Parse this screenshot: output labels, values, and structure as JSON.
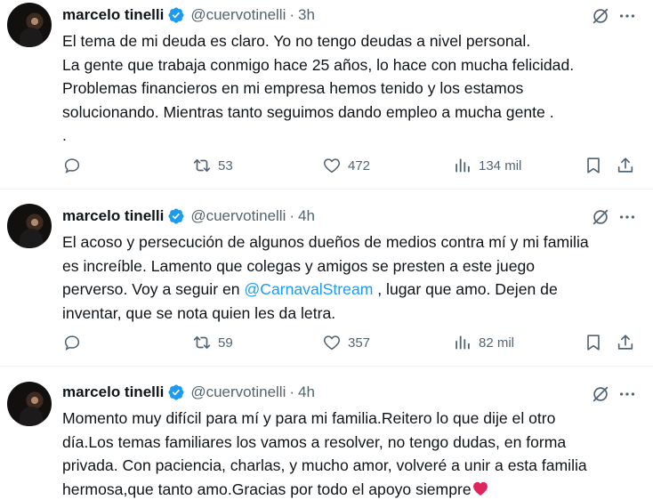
{
  "tweets": [
    {
      "name": "marcelo tinelli",
      "handle": "@cuervotinelli",
      "separator": "·",
      "time": "3h",
      "text": "El tema de mi deuda es claro. Yo no tengo deudas a nivel personal.\nLa gente que trabaja conmigo hace 25 años, lo  hace con mucha felicidad.\nProblemas financieros en  mi empresa hemos tenido y los estamos\nsolucionando. Mientras tanto seguimos  dando empleo a mucha gente .\n.",
      "retweets": "53",
      "likes": "472",
      "views": "134 mil"
    },
    {
      "name": "marcelo tinelli",
      "handle": "@cuervotinelli",
      "separator": "·",
      "time": "4h",
      "text_before": "El acoso y persecución de algunos dueños de medios contra mí y mi familia\nes increíble. Lamento que colegas y amigos se presten a este juego\nperverso. Voy a seguir en ",
      "mention": "@CarnavalStream",
      "text_after": " , lugar que amo. Dejen de\ninventar, que se nota quien les da letra.",
      "retweets": "59",
      "likes": "357",
      "views": "82 mil"
    },
    {
      "name": "marcelo tinelli",
      "handle": "@cuervotinelli",
      "separator": "·",
      "time": "4h",
      "text": "Momento muy difícil para mí y para mi familia.Reitero lo que dije el otro\ndía.Los temas familiares los vamos a resolver, no tengo dudas, en forma\nprivada. Con paciencia, charlas, y mucho amor, volveré a unir a esta familia\nhermosa,que tanto amo.Gracias por todo el apoyo siempre",
      "emoji": "red-heart-emoji"
    }
  ],
  "colors": {
    "text": "#0f1419",
    "muted": "#536471",
    "link": "#1d9bf0",
    "verified": "#1d9bf0",
    "heart": "#e0245e"
  }
}
